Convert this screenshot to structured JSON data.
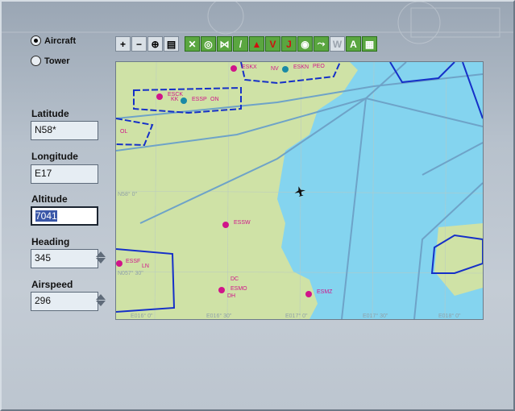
{
  "mode": {
    "aircraft_label": "Aircraft",
    "tower_label": "Tower",
    "selected": "Aircraft"
  },
  "fields": {
    "latitude": {
      "label": "Latitude",
      "value": "N58*"
    },
    "longitude": {
      "label": "Longitude",
      "value": "E17"
    },
    "altitude": {
      "label": "Altitude",
      "value": "7041"
    },
    "heading": {
      "label": "Heading",
      "value": "345"
    },
    "airspeed": {
      "label": "Airspeed",
      "value": "296"
    }
  },
  "toolbar": {
    "buttons": [
      "zoom-in-icon",
      "zoom-out-icon",
      "center-icon",
      "page-icon",
      "vor-icon",
      "ndb-icon",
      "ils-icon",
      "runway-icon",
      "triangle-icon",
      "v-icon",
      "j-icon",
      "route-icon",
      "airways-icon",
      "weather-icon",
      "altitude-icon",
      "terrain-icon"
    ]
  },
  "map": {
    "airports": [
      {
        "code": "ESKX"
      },
      {
        "code": "NV"
      },
      {
        "code": "ESKN"
      },
      {
        "code": "PEO"
      },
      {
        "code": "ESCK"
      },
      {
        "code": "KK"
      },
      {
        "code": "ESSP"
      },
      {
        "code": "ON"
      },
      {
        "code": "OL"
      },
      {
        "code": "ESSW"
      },
      {
        "code": "ESSF"
      },
      {
        "code": "LN"
      },
      {
        "code": "DC"
      },
      {
        "code": "ESMO"
      },
      {
        "code": "DH"
      },
      {
        "code": "ESMZ"
      }
    ],
    "grid_labels": {
      "lat_58_0": "N58° 0\"",
      "lat_57_30": "N057° 30\"",
      "lon_16": "E016° 0\"",
      "lon_16_30": "E016° 30\"",
      "lon_17": "E017° 0\"",
      "lon_17_30": "E017° 30\"",
      "lon_18": "E018° 0\""
    },
    "colors": {
      "sea": "#84d4ef",
      "land": "#cfe2a6",
      "airspace": "#1530c8",
      "airway": "#6ea3c8",
      "airport": "#d0148a"
    }
  }
}
